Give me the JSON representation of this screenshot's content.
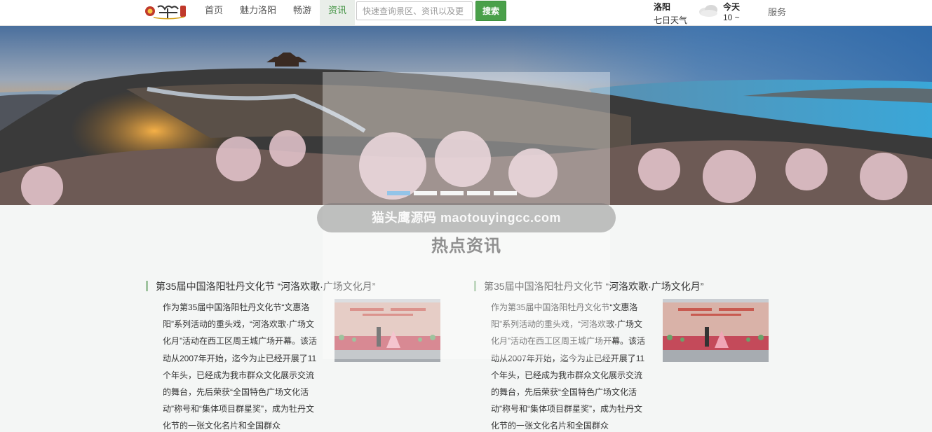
{
  "header": {
    "logo_text": "牡丹",
    "nav": [
      "首页",
      "魅力洛阳",
      "畅游",
      "资讯"
    ],
    "active_nav_index": 3,
    "search": {
      "placeholder": "快速查询景区、资讯以及更",
      "value": "",
      "button_label": "搜索"
    },
    "weather": {
      "city": "洛阳",
      "forecast_label": "七日天气",
      "day": "今天",
      "temp": "10 ~"
    },
    "service_label": "服务"
  },
  "banner": {
    "slide_count": 5,
    "active_slide": 0
  },
  "watermark": {
    "text": "猫头鹰源码 maotouyingcc.com"
  },
  "section": {
    "title": "热点资讯"
  },
  "news": [
    {
      "title": "第35届中国洛阳牡丹文化节 “河洛欢歌·广场文化月”",
      "body": "作为第35届中国洛阳牡丹文化节“文惠洛阳”系列活动的重头戏，“河洛欢歌·广场文化月”活动在西工区周王城广场开幕。该活动从2007年开始，迄今为止已经开展了11个年头，已经成为我市群众文化展示交流的舞台，先后荣获“全国特色广场文化活动”称号和“集体项目群星奖”，成为牡丹文化节的一张文化名片和全国群众"
    },
    {
      "title": "第35届中国洛阳牡丹文化节 “河洛欢歌·广场文化月”",
      "body": "作为第35届中国洛阳牡丹文化节“文惠洛阳”系列活动的重头戏，“河洛欢歌·广场文化月”活动在西工区周王城广场开幕。该活动从2007年开始，迄今为止已经开展了11个年头，已经成为我市群众文化展示交流的舞台，先后荣获“全国特色广场文化活动”称号和“集体项目群星奖”，成为牡丹文化节的一张文化名片和全国群众"
    }
  ]
}
